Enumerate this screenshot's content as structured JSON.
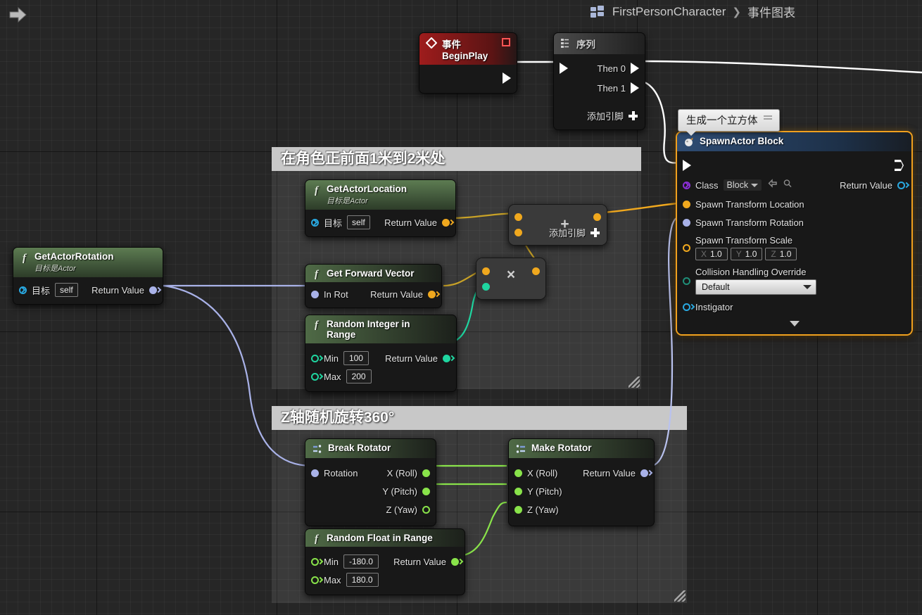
{
  "window": {
    "back_icon": "back-arrow-icon",
    "breadcrumb": {
      "icon": "blueprint-icon",
      "asset": "FirstPersonCharacter",
      "separator": "❯",
      "tab": "事件图表"
    }
  },
  "colors": {
    "exec_white": "#ffffff",
    "vector_gold": "#f0a81e",
    "rotator_lavender": "#a9b2e8",
    "float_green": "#89e34a",
    "int_teal": "#1fd6a0",
    "object_blue": "#29a8e0",
    "class_purple": "#8b2fd6",
    "selection_orange": "#f0a01e",
    "event_red": "#9e1c1c",
    "comment_header": "#c8c8c8"
  },
  "comments": [
    {
      "title": "在角色正前面1米到2米处"
    },
    {
      "title": "Z轴随机旋转360°"
    }
  ],
  "spawn_bubble": {
    "text": "生成一个立方体"
  },
  "nodes": {
    "event_beginplay": {
      "title": "事件BeginPlay",
      "icon": "event-diamond-icon",
      "badge": "node-breakpoint-icon"
    },
    "sequence": {
      "title": "序列",
      "icon": "sequence-icon",
      "then0": "Then 0",
      "then1": "Then 1",
      "add_pin": "添加引脚"
    },
    "get_actor_rotation": {
      "title": "GetActorRotation",
      "subtitle": "目标是Actor",
      "target_label": "目标",
      "target_value": "self",
      "return_label": "Return Value"
    },
    "get_actor_location": {
      "title": "GetActorLocation",
      "subtitle": "目标是Actor",
      "target_label": "目标",
      "target_value": "self",
      "return_label": "Return Value"
    },
    "get_forward_vector": {
      "title": "Get Forward Vector",
      "in_rot_label": "In Rot",
      "return_label": "Return Value"
    },
    "random_integer": {
      "title": "Random Integer in Range",
      "min_label": "Min",
      "min_value": "100",
      "max_label": "Max",
      "max_value": "200",
      "return_label": "Return Value"
    },
    "multiply": {
      "glyph": "×",
      "name": "multiply-node"
    },
    "add": {
      "glyph": "+",
      "add_pin": "添加引脚",
      "name": "add-node"
    },
    "break_rotator": {
      "title": "Break Rotator",
      "rotation_label": "Rotation",
      "x_label": "X (Roll)",
      "y_label": "Y (Pitch)",
      "z_label": "Z (Yaw)"
    },
    "make_rotator": {
      "title": "Make Rotator",
      "x_label": "X (Roll)",
      "y_label": "Y (Pitch)",
      "z_label": "Z (Yaw)",
      "return_label": "Return Value"
    },
    "random_float": {
      "title": "Random Float in Range",
      "min_label": "Min",
      "min_value": "-180.0",
      "max_label": "Max",
      "max_value": "180.0",
      "return_label": "Return Value"
    },
    "spawn_actor": {
      "title": "SpawnActor Block",
      "icon": "spawn-actor-icon",
      "class_label": "Class",
      "class_value": "Block",
      "class_browse_icon": "browse-back-icon",
      "class_search_icon": "magnifier-icon",
      "return_label": "Return Value",
      "location_label": "Spawn Transform Location",
      "rotation_label": "Spawn Transform Rotation",
      "scale_label": "Spawn Transform Scale",
      "scale_x_axis": "X",
      "scale_x": "1.0",
      "scale_y_axis": "Y",
      "scale_y": "1.0",
      "scale_z_axis": "Z",
      "scale_z": "1.0",
      "collision_label": "Collision Handling Override",
      "collision_value": "Default",
      "instigator_label": "Instigator",
      "expand_icon": "chevron-down-icon"
    }
  }
}
